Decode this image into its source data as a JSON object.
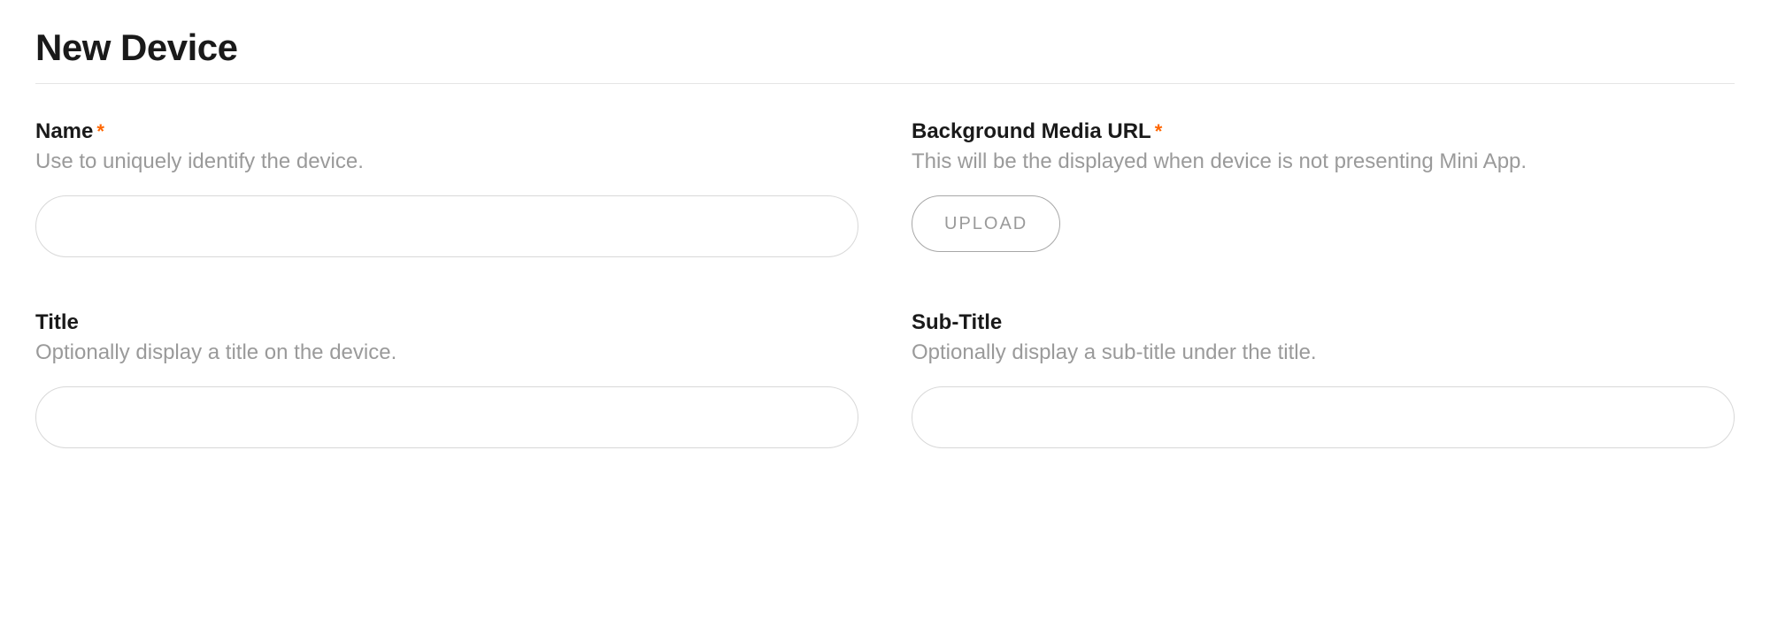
{
  "header": {
    "title": "New Device"
  },
  "form": {
    "required_symbol": "*",
    "name": {
      "label": "Name",
      "help": "Use to uniquely identify the device.",
      "value": "",
      "required": true
    },
    "background_media_url": {
      "label": "Background Media URL",
      "help": "This will be the displayed when device is not presenting Mini App.",
      "upload_label": "UPLOAD",
      "required": true
    },
    "title": {
      "label": "Title",
      "help": "Optionally display a title on the device.",
      "value": "",
      "required": false
    },
    "subtitle": {
      "label": "Sub-Title",
      "help": "Optionally display a sub-title under the title.",
      "value": "",
      "required": false
    }
  }
}
